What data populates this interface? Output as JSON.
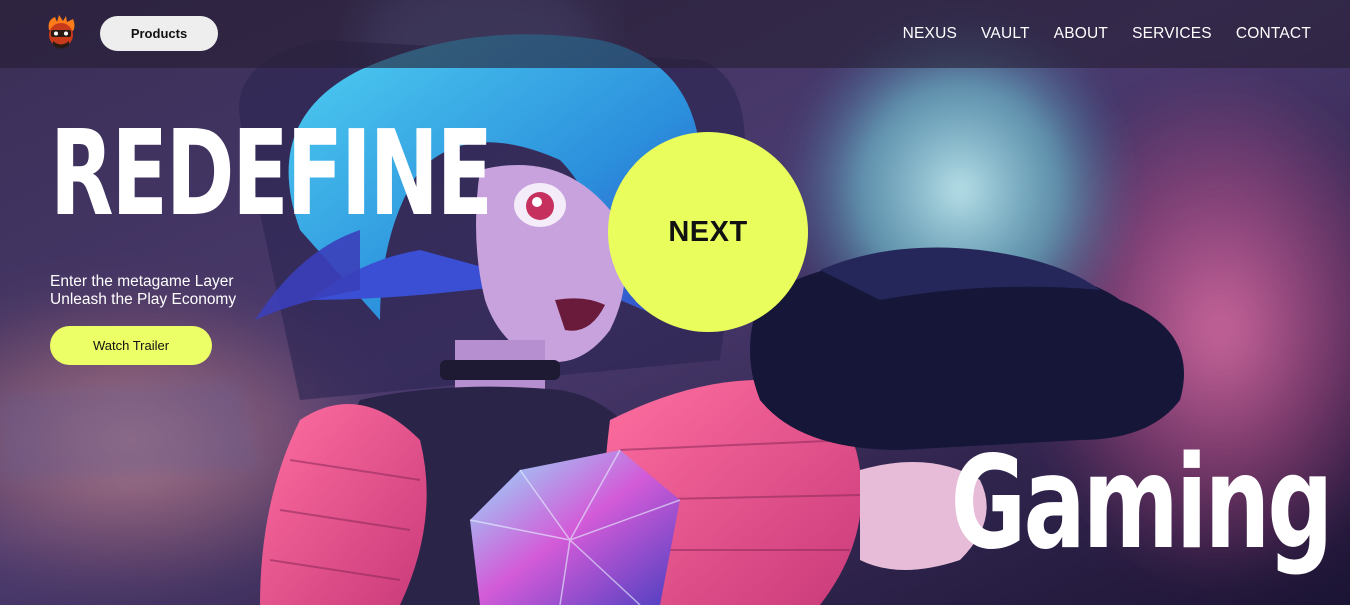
{
  "header": {
    "logo_icon": "ninja-mascot-logo-icon",
    "products_label": "Products",
    "nav": [
      "NEXUS",
      "VAULT",
      "ABOUT",
      "SERVICES",
      "CONTACT"
    ]
  },
  "hero": {
    "headline": "REDEFINE",
    "tagline": [
      "Enter the metagame Layer",
      "Unleash the Play Economy"
    ],
    "watch_trailer_label": "Watch Trailer",
    "next_label": "NEXT",
    "subheadline": "Gaming",
    "background": "anime-gamer-character-artwork"
  },
  "colors": {
    "accent": "#e9fe5d",
    "text": "#ffffff",
    "nav_bg": "#261e34"
  }
}
